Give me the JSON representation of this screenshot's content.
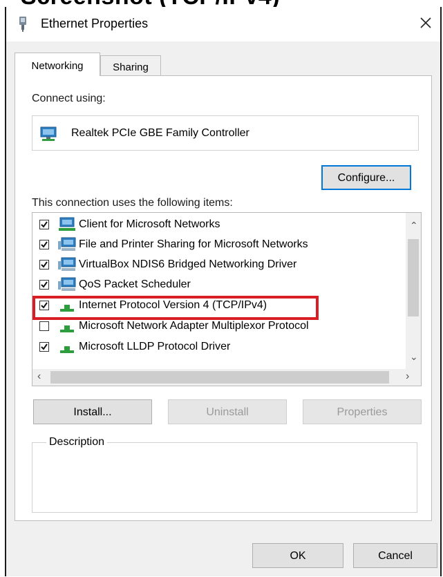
{
  "window": {
    "title": "Ethernet Properties"
  },
  "tabs": [
    {
      "label": "Networking",
      "active": true
    },
    {
      "label": "Sharing",
      "active": false
    }
  ],
  "connect_using_label": "Connect using:",
  "adapter_name": "Realtek PCIe GBE Family Controller",
  "configure_button": "Configure...",
  "items_label": "This connection uses the following items:",
  "items": [
    {
      "label": "Client for Microsoft Networks",
      "checked": true,
      "icon": "network-client-icon"
    },
    {
      "label": "File and Printer Sharing for Microsoft Networks",
      "checked": true,
      "icon": "network-service-icon"
    },
    {
      "label": "VirtualBox NDIS6 Bridged Networking Driver",
      "checked": true,
      "icon": "network-service-icon"
    },
    {
      "label": "QoS Packet Scheduler",
      "checked": true,
      "icon": "network-service-icon"
    },
    {
      "label": "Internet Protocol Version 4 (TCP/IPv4)",
      "checked": true,
      "icon": "protocol-icon",
      "highlighted": true
    },
    {
      "label": "Microsoft Network Adapter Multiplexor Protocol",
      "checked": false,
      "icon": "protocol-icon"
    },
    {
      "label": "Microsoft LLDP Protocol Driver",
      "checked": true,
      "icon": "protocol-icon"
    }
  ],
  "buttons": {
    "install": "Install...",
    "uninstall": "Uninstall",
    "properties": "Properties"
  },
  "description_label": "Description",
  "footer": {
    "ok": "OK",
    "cancel": "Cancel"
  },
  "colors": {
    "highlight": "#d81e24",
    "focus": "#0078d7",
    "protocol_green": "#2e9d3e",
    "network_blue": "#2d7fc1"
  }
}
